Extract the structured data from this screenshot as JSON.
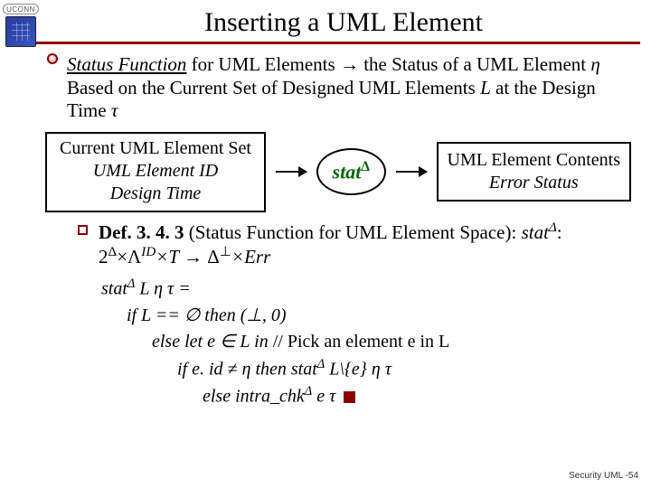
{
  "brand": {
    "text": "UCONN"
  },
  "title": "Inserting a UML Element",
  "status_desc": {
    "underline_italic": "Status Function",
    "part1": " for UML Elements ",
    "arrow": "→",
    "part2": " the Status of a UML Element ",
    "eta": "η",
    "part3": " Based on the Current Set of Designed UML Elements ",
    "L": "L",
    "part4": " at the Design Time ",
    "tau": "τ"
  },
  "diagram": {
    "left": {
      "line1": "Current UML Element Set",
      "line2": "UML Element ID",
      "line3": "Design Time"
    },
    "oval_prefix": "stat",
    "oval_sup": "Δ",
    "right": {
      "line1": "UML Element Contents",
      "line2": "Error Status"
    }
  },
  "definition": {
    "label": "Def. 3. 4. 3",
    "paren": " (Status Function for UML Element Space): ",
    "fn": "stat",
    "fn_sup": "Δ",
    "sig": ": 2",
    "sig_sup": "Δ",
    "mid": "×Λ",
    "mid_sup": "ID",
    "t": "×T ",
    "arrow": "→",
    "cod": " Δ",
    "cod_sup": "⊥",
    "err": "×Err"
  },
  "algo": {
    "l1_a": "stat",
    "l1_sup": "Δ",
    "l1_b": " L  η  τ =",
    "l2_a": "if L == ",
    "empty": "∅",
    "l2_b": " then (",
    "bot": "⊥",
    "l2_c": ", 0)",
    "l3_a": "else let e ",
    "in": "∈",
    "l3_b": " L in ",
    "l3_comment": "// Pick an element e in L",
    "l4_a": "if e. id ",
    "neq": "≠",
    "l4_b": " η then stat",
    "l4_sup": "Δ",
    "l4_c": " L\\{e} η τ",
    "l5_a": "else intra_chk",
    "l5_sup": "Δ",
    "l5_b": " e τ "
  },
  "footer": "Security UML -54"
}
